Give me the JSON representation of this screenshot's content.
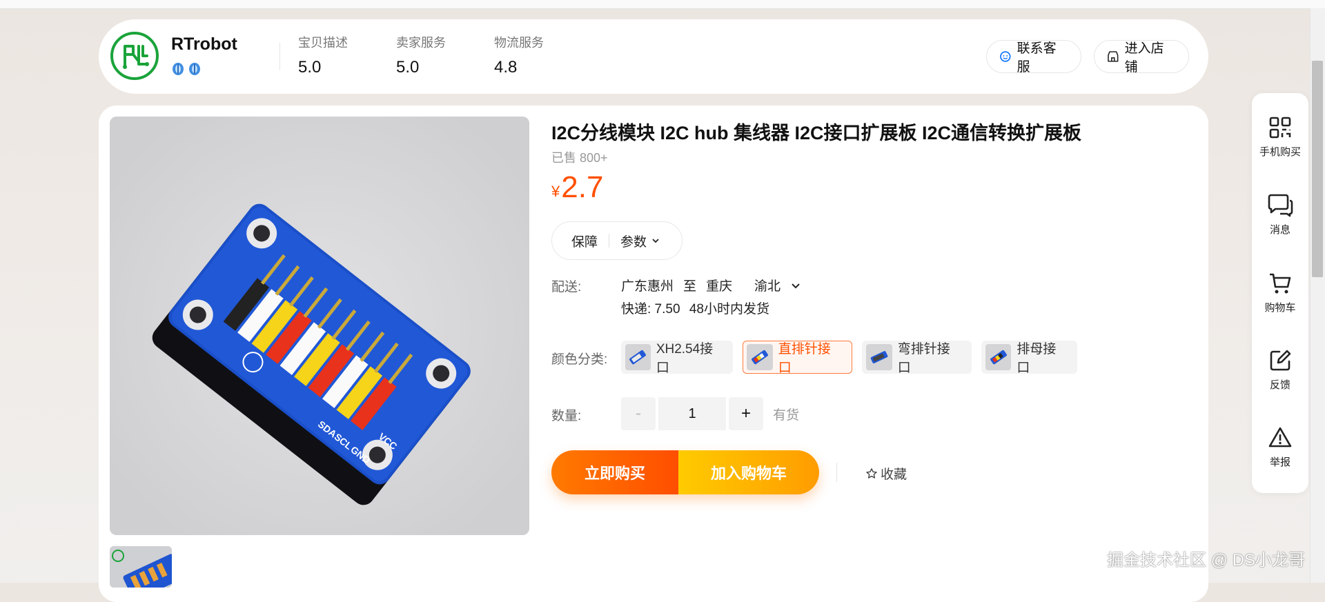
{
  "store": {
    "name": "RTrobot",
    "scores": [
      {
        "label": "宝贝描述",
        "value": "5.0"
      },
      {
        "label": "卖家服务",
        "value": "5.0"
      },
      {
        "label": "物流服务",
        "value": "4.8"
      }
    ],
    "contact_label": "联系客服",
    "enter_store_label": "进入店铺"
  },
  "product": {
    "title": "I2C分线模块 I2C hub 集线器 I2C接口扩展板 I2C通信转换扩展板",
    "sold": "已售 800+",
    "currency": "¥",
    "price": "2.7",
    "guarantee_label": "保障",
    "params_label": "参数",
    "shipping": {
      "label": "配送:",
      "from": "广东惠州",
      "to_word": "至",
      "dest_city": "重庆",
      "dest_district": "渝北",
      "express": "快递: 7.50",
      "dispatch": "48小时内发货"
    },
    "color_label": "颜色分类:",
    "variants": [
      {
        "label": "XH2.54接口",
        "selected": false
      },
      {
        "label": "直排针接口",
        "selected": true
      },
      {
        "label": "弯排针接口",
        "selected": false
      },
      {
        "label": "排母接口",
        "selected": false
      }
    ],
    "quantity_label": "数量:",
    "quantity_minus": "-",
    "quantity": "1",
    "quantity_plus": "+",
    "stock": "有货",
    "buy_now": "立即购买",
    "add_cart": "加入购物车",
    "favorite": "收藏"
  },
  "board_labels": [
    "GND",
    "VCC",
    "SCL",
    "SDA"
  ],
  "sidebar": [
    {
      "label": "手机购买",
      "icon": "qrcode-icon"
    },
    {
      "label": "消息",
      "icon": "message-icon"
    },
    {
      "label": "购物车",
      "icon": "cart-icon"
    },
    {
      "label": "反馈",
      "icon": "edit-icon"
    },
    {
      "label": "举报",
      "icon": "warning-icon"
    }
  ],
  "watermark": "掘金技术社区 @ DS小龙哥",
  "colors": {
    "accent": "#ff5000",
    "buy_gradient": [
      "#ff7a00",
      "#ff4e00"
    ],
    "cart_gradient": [
      "#ffcb00",
      "#ff9c00"
    ],
    "logo_green": "#1aa33a"
  }
}
